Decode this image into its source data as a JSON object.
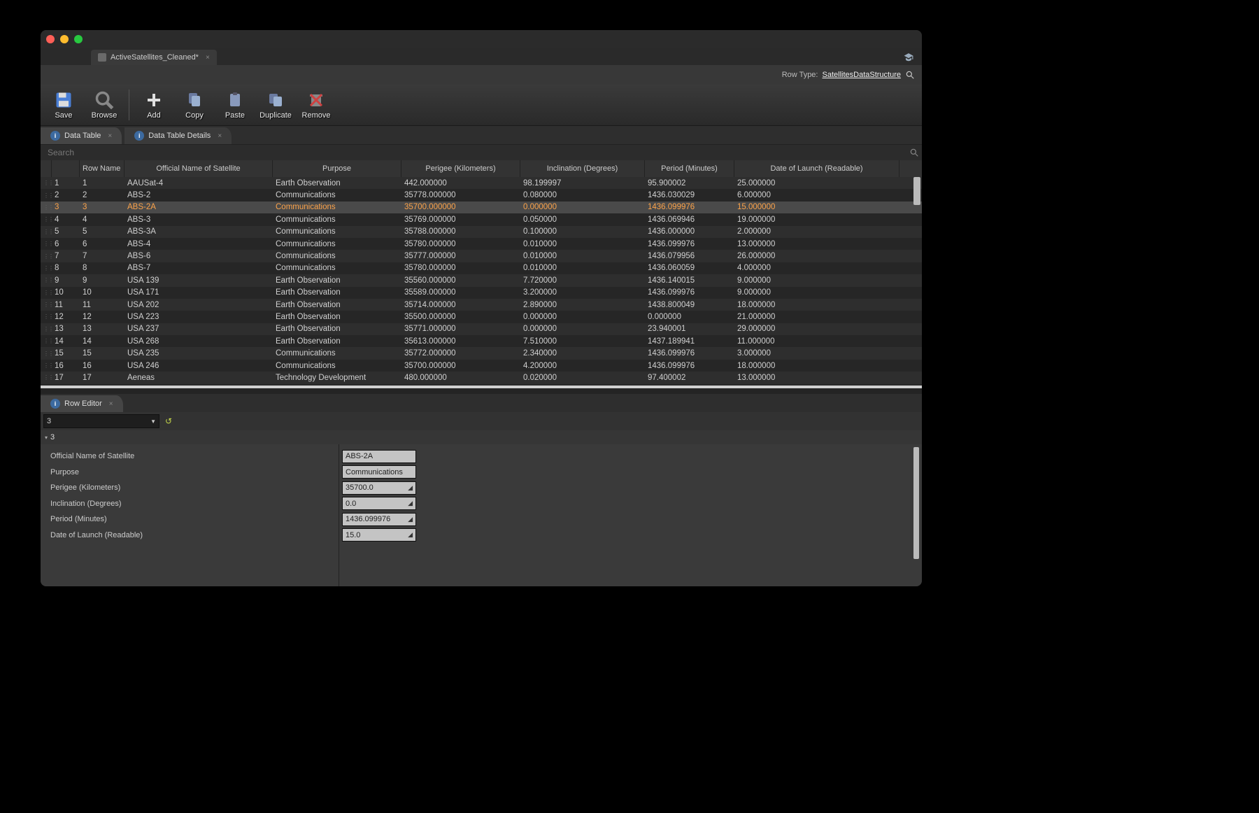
{
  "tab": {
    "title": "ActiveSatellites_Cleaned*"
  },
  "rowtype": {
    "label": "Row Type:",
    "value": "SatellitesDataStructure"
  },
  "toolbar": {
    "save": "Save",
    "browse": "Browse",
    "add": "Add",
    "copy": "Copy",
    "paste": "Paste",
    "duplicate": "Duplicate",
    "remove": "Remove"
  },
  "subtabs": {
    "datatable": "Data Table",
    "details": "Data Table Details"
  },
  "search": {
    "placeholder": "Search"
  },
  "columns": {
    "rowname": "Row Name",
    "name": "Official Name of Satellite",
    "purpose": "Purpose",
    "perigee": "Perigee (Kilometers)",
    "incl": "Inclination (Degrees)",
    "period": "Period (Minutes)",
    "launch": "Date of Launch (Readable)"
  },
  "selectedIndex": 2,
  "rows": [
    {
      "idx": "1",
      "rn": "1",
      "name": "AAUSat-4",
      "purpose": "Earth Observation",
      "perigee": "442.000000",
      "incl": "98.199997",
      "period": "95.900002",
      "launch": "25.000000"
    },
    {
      "idx": "2",
      "rn": "2",
      "name": "ABS-2",
      "purpose": "Communications",
      "perigee": "35778.000000",
      "incl": "0.080000",
      "period": "1436.030029",
      "launch": "6.000000"
    },
    {
      "idx": "3",
      "rn": "3",
      "name": "ABS-2A",
      "purpose": "Communications",
      "perigee": "35700.000000",
      "incl": "0.000000",
      "period": "1436.099976",
      "launch": "15.000000"
    },
    {
      "idx": "4",
      "rn": "4",
      "name": "ABS-3",
      "purpose": "Communications",
      "perigee": "35769.000000",
      "incl": "0.050000",
      "period": "1436.069946",
      "launch": "19.000000"
    },
    {
      "idx": "5",
      "rn": "5",
      "name": "ABS-3A",
      "purpose": "Communications",
      "perigee": "35788.000000",
      "incl": "0.100000",
      "period": "1436.000000",
      "launch": "2.000000"
    },
    {
      "idx": "6",
      "rn": "6",
      "name": "ABS-4",
      "purpose": "Communications",
      "perigee": "35780.000000",
      "incl": "0.010000",
      "period": "1436.099976",
      "launch": "13.000000"
    },
    {
      "idx": "7",
      "rn": "7",
      "name": "ABS-6",
      "purpose": "Communications",
      "perigee": "35777.000000",
      "incl": "0.010000",
      "period": "1436.079956",
      "launch": "26.000000"
    },
    {
      "idx": "8",
      "rn": "8",
      "name": "ABS-7",
      "purpose": "Communications",
      "perigee": "35780.000000",
      "incl": "0.010000",
      "period": "1436.060059",
      "launch": "4.000000"
    },
    {
      "idx": "9",
      "rn": "9",
      "name": "USA 139",
      "purpose": "Earth Observation",
      "perigee": "35560.000000",
      "incl": "7.720000",
      "period": "1436.140015",
      "launch": "9.000000"
    },
    {
      "idx": "10",
      "rn": "10",
      "name": "USA 171",
      "purpose": "Earth Observation",
      "perigee": "35589.000000",
      "incl": "3.200000",
      "period": "1436.099976",
      "launch": "9.000000"
    },
    {
      "idx": "11",
      "rn": "11",
      "name": "USA 202",
      "purpose": "Earth Observation",
      "perigee": "35714.000000",
      "incl": "2.890000",
      "period": "1438.800049",
      "launch": "18.000000"
    },
    {
      "idx": "12",
      "rn": "12",
      "name": "USA 223",
      "purpose": "Earth Observation",
      "perigee": "35500.000000",
      "incl": "0.000000",
      "period": "0.000000",
      "launch": "21.000000"
    },
    {
      "idx": "13",
      "rn": "13",
      "name": "USA 237",
      "purpose": "Earth Observation",
      "perigee": "35771.000000",
      "incl": "0.000000",
      "period": "23.940001",
      "launch": "29.000000"
    },
    {
      "idx": "14",
      "rn": "14",
      "name": "USA 268",
      "purpose": "Earth Observation",
      "perigee": "35613.000000",
      "incl": "7.510000",
      "period": "1437.189941",
      "launch": "11.000000"
    },
    {
      "idx": "15",
      "rn": "15",
      "name": "USA 235",
      "purpose": "Communications",
      "perigee": "35772.000000",
      "incl": "2.340000",
      "period": "1436.099976",
      "launch": "3.000000"
    },
    {
      "idx": "16",
      "rn": "16",
      "name": "USA 246",
      "purpose": "Communications",
      "perigee": "35700.000000",
      "incl": "4.200000",
      "period": "1436.099976",
      "launch": "18.000000"
    },
    {
      "idx": "17",
      "rn": "17",
      "name": "Aeneas",
      "purpose": "Technology Development",
      "perigee": "480.000000",
      "incl": "0.020000",
      "period": "97.400002",
      "launch": "13.000000"
    }
  ],
  "roweditor": {
    "tab": "Row Editor",
    "selected": "3",
    "header": "3"
  },
  "fields": {
    "name": {
      "label": "Official Name of Satellite",
      "value": "ABS-2A"
    },
    "purpose": {
      "label": "Purpose",
      "value": "Communications"
    },
    "perigee": {
      "label": "Perigee (Kilometers)",
      "value": "35700.0"
    },
    "incl": {
      "label": "Inclination (Degrees)",
      "value": "0.0"
    },
    "period": {
      "label": "Period (Minutes)",
      "value": "1436.099976"
    },
    "launch": {
      "label": "Date of Launch (Readable)",
      "value": "15.0"
    }
  }
}
